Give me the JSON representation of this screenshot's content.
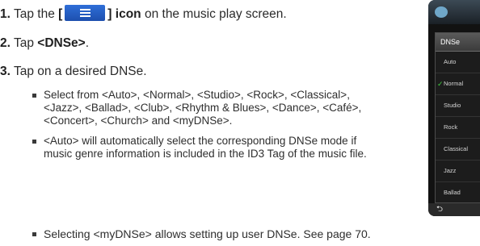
{
  "steps": [
    {
      "num": "1.",
      "pre": "Tap the ",
      "open_bracket": "[",
      "close_bracket": "]",
      "icon_word": "icon",
      "post": " on the music play screen."
    },
    {
      "num": "2.",
      "pre": "Tap ",
      "bold": "<DNSe>",
      "post": "."
    },
    {
      "num": "3.",
      "text": "Tap on a desired DNSe."
    }
  ],
  "bullets": [
    "Select from <Auto>, <Normal>, <Studio>, <Rock>, <Classical>, <Jazz>, <Ballad>, <Club>, <Rhythm & Blues>, <Dance>, <Café>, <Concert>, <Church> and <myDNSe>.",
    "<Auto> will automatically select the corresponding DNSe mode if music genre information is included in the ID3 Tag of the music file."
  ],
  "last_bullet": "Selecting <myDNSe> allows setting up user DNSe. See page 70.",
  "menu_icon": "menu-icon",
  "phone": {
    "popup_title": "DNSe",
    "options": [
      "Auto",
      "Normal",
      "Studio",
      "Rock",
      "Classical",
      "Jazz",
      "Ballad"
    ],
    "selected": "Normal",
    "back_icon": "back-arrow-icon",
    "check_icon": "check-icon"
  },
  "colors": {
    "menu_button": "#2f6fd8",
    "check": "#3fcf3f"
  }
}
